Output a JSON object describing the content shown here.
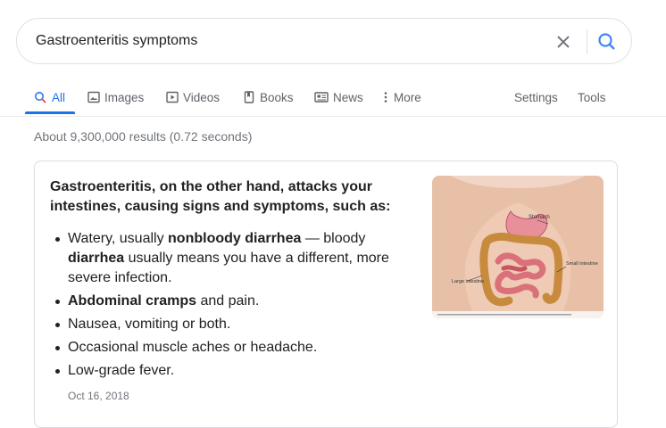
{
  "search": {
    "query": "Gastroenteritis symptoms",
    "clear_icon": "close-icon",
    "search_icon": "magnifier-icon"
  },
  "tabs": [
    {
      "label": "All",
      "icon": "search-icon",
      "active": true
    },
    {
      "label": "Images",
      "icon": "image-icon"
    },
    {
      "label": "Videos",
      "icon": "play-icon"
    },
    {
      "label": "Books",
      "icon": "book-icon"
    },
    {
      "label": "News",
      "icon": "newspaper-icon"
    },
    {
      "label": "More",
      "icon": "kebab-icon"
    }
  ],
  "tools": {
    "settings": "Settings",
    "tools": "Tools"
  },
  "results_stats": "About 9,300,000 results (0.72 seconds)",
  "snippet": {
    "heading": "Gastroenteritis, on the other hand, attacks your intestines, causing signs and symptoms, such as:",
    "items": [
      {
        "pre": "Watery, usually ",
        "b1": "nonbloody diarrhea",
        "mid": " — bloody ",
        "b2": "diarrhea",
        "post": " usually means you have a different, more severe infection."
      },
      {
        "b1": "Abdominal cramps",
        "post": " and pain."
      },
      {
        "text": "Nausea, vomiting or both."
      },
      {
        "text": "Occasional muscle aches or headache."
      },
      {
        "text": "Low-grade fever."
      }
    ],
    "date": "Oct 16, 2018",
    "image_labels": {
      "stomach": "Stomach",
      "small": "Small intestine",
      "large": "Large intestine"
    }
  },
  "colors": {
    "accent": "#1a73e8",
    "text": "#202124",
    "muted": "#70757a",
    "border": "#dadce0"
  }
}
